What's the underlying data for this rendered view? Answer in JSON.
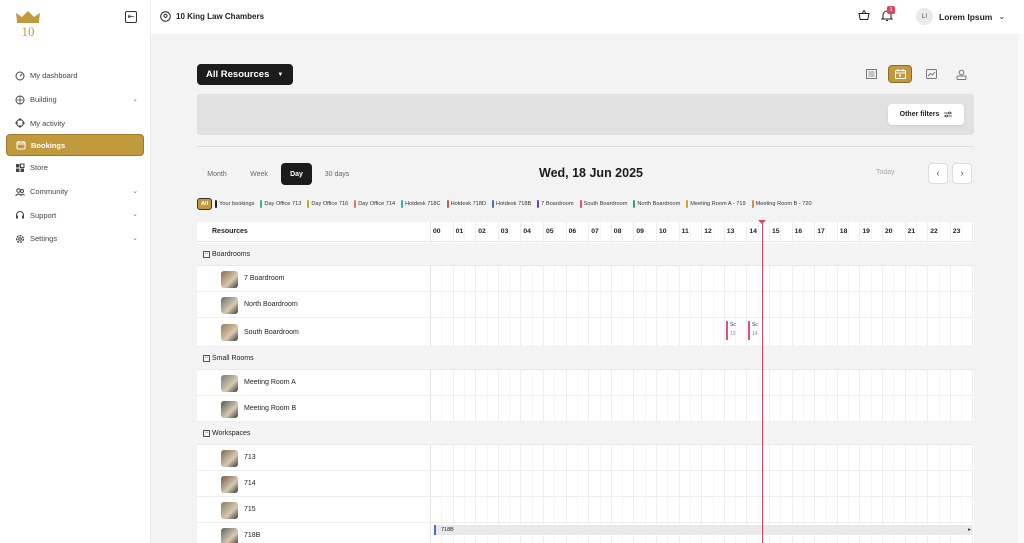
{
  "sidebar": {
    "logo_text": "10",
    "items": [
      {
        "label": "My dashboard",
        "icon": "dashboard-icon",
        "chevron": false
      },
      {
        "label": "Building",
        "icon": "building-icon",
        "chevron": true
      },
      {
        "label": "My activity",
        "icon": "activity-icon",
        "chevron": false
      },
      {
        "label": "Bookings",
        "icon": "calendar-icon",
        "chevron": false,
        "active": true
      },
      {
        "label": "Store",
        "icon": "store-icon",
        "chevron": false
      },
      {
        "label": "Community",
        "icon": "community-icon",
        "chevron": true
      },
      {
        "label": "Support",
        "icon": "support-icon",
        "chevron": true
      },
      {
        "label": "Settings",
        "icon": "settings-icon",
        "chevron": true
      }
    ]
  },
  "header": {
    "location": "10 King Law Chambers",
    "notification_count": "1",
    "user_initials": "LI",
    "user_name": "Lorem Ipsum"
  },
  "toolbar": {
    "resource_select": "All Resources",
    "other_filters": "Other filters",
    "accent": "#c19a3d"
  },
  "calendar": {
    "tabs": [
      "Month",
      "Week",
      "Day",
      "30 days"
    ],
    "active_tab": "Day",
    "date_title": "Wed, 18 Jun 2025",
    "today_label": "Today",
    "prev": "‹",
    "next": "›"
  },
  "legend": [
    {
      "label": "All",
      "color": "#c19a3d"
    },
    {
      "label": "Your bookings",
      "color": "#222222"
    },
    {
      "label": "Day Office 713",
      "color": "#3cb878"
    },
    {
      "label": "Day Office 716",
      "color": "#d4a514"
    },
    {
      "label": "Day Office 714",
      "color": "#e0736a"
    },
    {
      "label": "Hotdesk 718C",
      "color": "#2bb5b5"
    },
    {
      "label": "Hotdesk 718D",
      "color": "#d9534f"
    },
    {
      "label": "Hotdesk 718B",
      "color": "#3b6fd4"
    },
    {
      "label": "7 Boardroom",
      "color": "#7b3fb6"
    },
    {
      "label": "South Boardroom",
      "color": "#d94f8a"
    },
    {
      "label": "North Boardroom",
      "color": "#2fa36b"
    },
    {
      "label": "Meeting Room A - 719",
      "color": "#d4a514"
    },
    {
      "label": "Meeting Room B - 720",
      "color": "#e08a45"
    }
  ],
  "grid": {
    "resources_header": "Resources",
    "hours": [
      "00",
      "01",
      "02",
      "03",
      "04",
      "05",
      "06",
      "07",
      "08",
      "09",
      "10",
      "11",
      "12",
      "13",
      "14",
      "15",
      "16",
      "17",
      "18",
      "19",
      "20",
      "21",
      "22",
      "23"
    ],
    "groups": [
      {
        "name": "Boardrooms",
        "items": [
          "7 Boardroom",
          "North Boardroom",
          "South Boardroom"
        ]
      },
      {
        "name": "Small Rooms",
        "items": [
          "Meeting Room A",
          "Meeting Room B"
        ]
      },
      {
        "name": "Workspaces",
        "items": [
          "713",
          "714",
          "715",
          "718B"
        ]
      }
    ],
    "events": [
      {
        "resource": "South Boardroom",
        "title": "Sc",
        "sub": "13"
      },
      {
        "resource": "South Boardroom",
        "title": "Sc",
        "sub": "14"
      },
      {
        "resource": "718B",
        "title": "718B",
        "sub": ""
      }
    ]
  }
}
